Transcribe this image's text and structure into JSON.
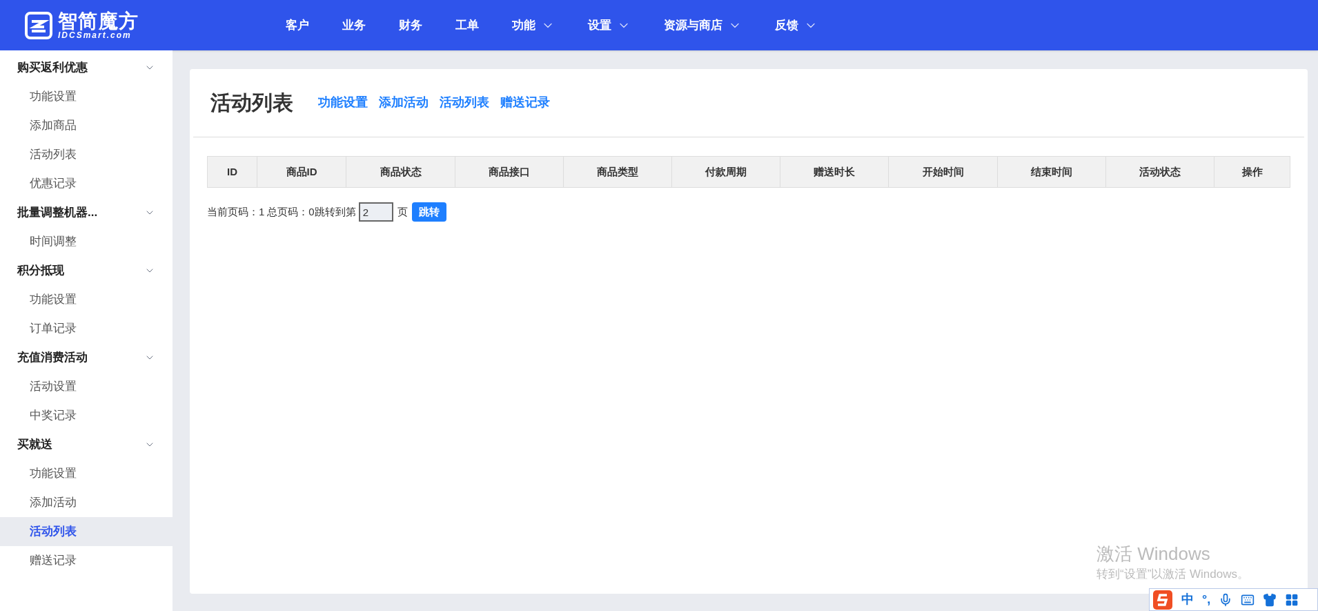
{
  "header": {
    "logo_text": "智简魔方",
    "logo_subtext": "IDCSmart.com",
    "nav": [
      {
        "label": "客户",
        "has_menu": false
      },
      {
        "label": "业务",
        "has_menu": false
      },
      {
        "label": "财务",
        "has_menu": false
      },
      {
        "label": "工单",
        "has_menu": false
      },
      {
        "label": "功能",
        "has_menu": true
      },
      {
        "label": "设置",
        "has_menu": true
      },
      {
        "label": "资源与商店",
        "has_menu": true
      },
      {
        "label": "反馈",
        "has_menu": true
      }
    ]
  },
  "sidebar": {
    "groups": [
      {
        "label": "购买返利优惠",
        "expanded": true,
        "children": [
          {
            "label": "功能设置",
            "selected": false
          },
          {
            "label": "添加商品",
            "selected": false
          },
          {
            "label": "活动列表",
            "selected": false
          },
          {
            "label": "优惠记录",
            "selected": false
          }
        ]
      },
      {
        "label": "批量调整机器...",
        "expanded": true,
        "children": [
          {
            "label": "时间调整",
            "selected": false
          }
        ]
      },
      {
        "label": "积分抵现",
        "expanded": true,
        "children": [
          {
            "label": "功能设置",
            "selected": false
          },
          {
            "label": "订单记录",
            "selected": false
          }
        ]
      },
      {
        "label": "充值消费活动",
        "expanded": true,
        "children": [
          {
            "label": "活动设置",
            "selected": false
          },
          {
            "label": "中奖记录",
            "selected": false
          }
        ]
      },
      {
        "label": "买就送",
        "expanded": true,
        "children": [
          {
            "label": "功能设置",
            "selected": false
          },
          {
            "label": "添加活动",
            "selected": false
          },
          {
            "label": "活动列表",
            "selected": true
          },
          {
            "label": "赠送记录",
            "selected": false
          }
        ]
      }
    ]
  },
  "page": {
    "title": "活动列表",
    "links": [
      "功能设置",
      "添加活动",
      "活动列表",
      "赠送记录"
    ],
    "table": {
      "columns": [
        "ID",
        "商品ID",
        "商品状态",
        "商品接口",
        "商品类型",
        "付款周期",
        "赠送时长",
        "开始时间",
        "结束时间",
        "活动状态",
        "操作"
      ]
    },
    "pagination": {
      "current_label": "当前页码：1",
      "total_label": "总页码：0",
      "jump_label": "跳转到第",
      "jump_value": "2",
      "page_unit": "页",
      "jump_button": "跳转"
    }
  },
  "os_overlay": {
    "activation_title": "激活 Windows",
    "activation_hint": "转到“设置”以激活 Windows。",
    "ime_items": [
      "中",
      "°,"
    ]
  }
}
